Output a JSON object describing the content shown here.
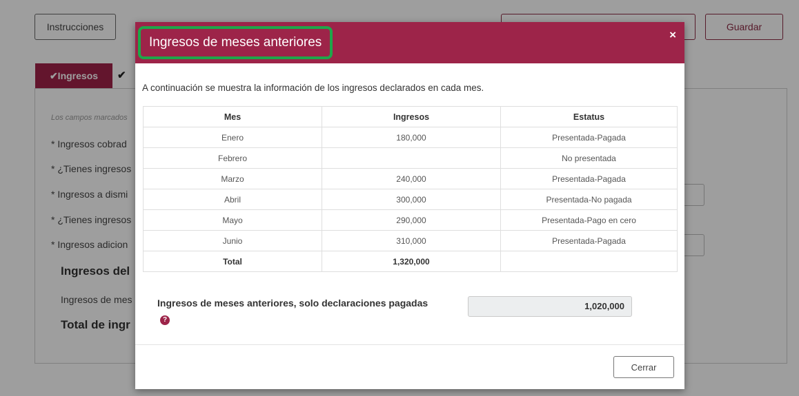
{
  "background": {
    "instructions_label": "Instrucciones",
    "save_label": "Guardar",
    "tab_active": "✔Ingresos",
    "tab_next": "✔",
    "note": "Los campos marcados",
    "fields": [
      "* Ingresos cobrad",
      "* ¿Tienes ingresos",
      "* Ingresos a dismi",
      "* ¿Tienes ingresos",
      "* Ingresos adicion"
    ],
    "section_heading": "Ingresos del",
    "prev_months_label": "Ingresos de mes",
    "total_heading": "Total de ingr"
  },
  "modal": {
    "title": "Ingresos de meses anteriores",
    "close_glyph": "×",
    "description": "A continuación se muestra la información de los ingresos declarados en cada mes.",
    "table": {
      "headers": [
        "Mes",
        "Ingresos",
        "Estatus"
      ],
      "rows": [
        {
          "mes": "Enero",
          "ingresos": "180,000",
          "estatus": "Presentada-Pagada"
        },
        {
          "mes": "Febrero",
          "ingresos": "",
          "estatus": "No presentada"
        },
        {
          "mes": "Marzo",
          "ingresos": "240,000",
          "estatus": "Presentada-Pagada"
        },
        {
          "mes": "Abril",
          "ingresos": "300,000",
          "estatus": "Presentada-No pagada"
        },
        {
          "mes": "Mayo",
          "ingresos": "290,000",
          "estatus": "Presentada-Pago en cero"
        },
        {
          "mes": "Junio",
          "ingresos": "310,000",
          "estatus": "Presentada-Pagada"
        }
      ],
      "total": {
        "label": "Total",
        "ingresos": "1,320,000",
        "estatus": ""
      }
    },
    "summary_label": "Ingresos de meses anteriores, solo declaraciones pagadas",
    "summary_help_icon": "?",
    "summary_value": "1,020,000",
    "close_button_label": "Cerrar"
  },
  "colors": {
    "accent": "#9d2449",
    "highlight": "#1fa64a"
  }
}
